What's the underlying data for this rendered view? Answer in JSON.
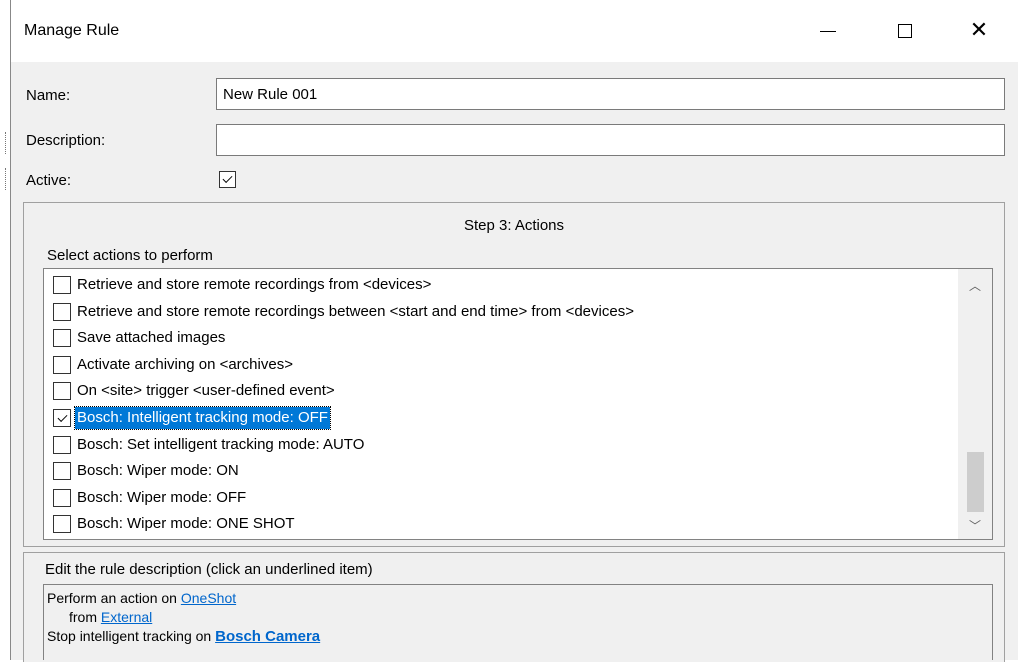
{
  "window": {
    "title": "Manage Rule",
    "minimize_icon": "minimize-icon",
    "maximize_icon": "maximize-icon",
    "close_icon": "close-icon",
    "close_glyph": "✕"
  },
  "form": {
    "name_label": "Name:",
    "name_value": "New Rule 001",
    "description_label": "Description:",
    "description_value": "",
    "active_label": "Active:",
    "active_checked": true
  },
  "actions": {
    "step_title": "Step 3: Actions",
    "subtitle": "Select actions to perform",
    "items": [
      {
        "label": "Retrieve and store remote recordings from <devices>",
        "checked": false,
        "selected": false
      },
      {
        "label": "Retrieve and store remote recordings between <start and end time> from <devices>",
        "checked": false,
        "selected": false
      },
      {
        "label": "Save attached images",
        "checked": false,
        "selected": false
      },
      {
        "label": "Activate archiving on <archives>",
        "checked": false,
        "selected": false
      },
      {
        "label": "On <site> trigger <user-defined event>",
        "checked": false,
        "selected": false
      },
      {
        "label": "Bosch: Intelligent tracking mode: OFF",
        "checked": true,
        "selected": true
      },
      {
        "label": "Bosch: Set intelligent tracking mode: AUTO",
        "checked": false,
        "selected": false
      },
      {
        "label": "Bosch: Wiper mode: ON",
        "checked": false,
        "selected": false
      },
      {
        "label": "Bosch: Wiper mode: OFF",
        "checked": false,
        "selected": false
      },
      {
        "label": "Bosch: Wiper mode: ONE SHOT",
        "checked": false,
        "selected": false
      }
    ],
    "scroll_up_glyph": "︿",
    "scroll_down_glyph": "﹀"
  },
  "rule_description": {
    "subtitle": "Edit the rule description (click an underlined item)",
    "line1_prefix": "Perform an action on ",
    "line1_link": "OneShot",
    "line2_prefix": "from ",
    "line2_link": "External",
    "line3_prefix": "Stop intelligent tracking on ",
    "line3_link": "Bosch Camera"
  },
  "colors": {
    "selection": "#0078d7",
    "link": "#0066cc"
  }
}
